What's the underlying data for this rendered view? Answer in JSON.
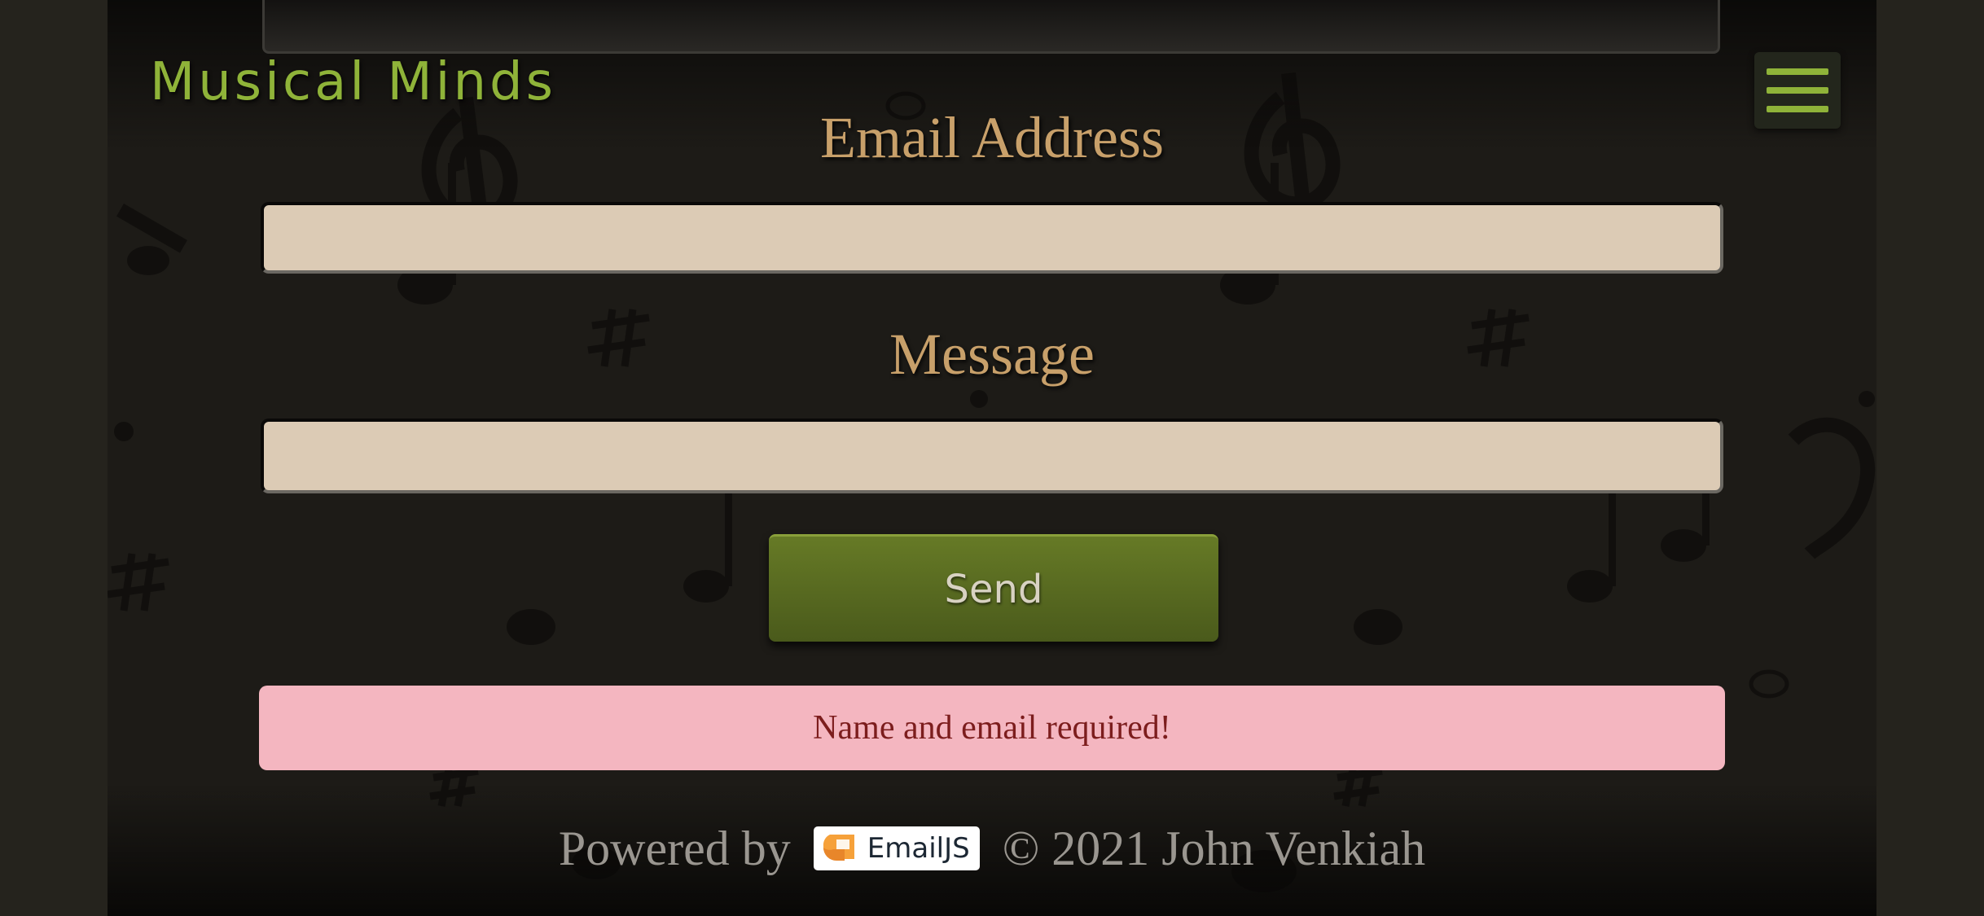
{
  "header": {
    "brand": "Musical Minds",
    "menu_icon": "hamburger-menu-icon"
  },
  "form": {
    "email_label": "Email Address",
    "email_value": "",
    "message_label": "Message",
    "message_value": "",
    "send_label": "Send"
  },
  "alert": {
    "text": "Name and email required!"
  },
  "footer": {
    "powered_by": "Powered by",
    "badge_label": "EmailJS",
    "copyright": "© 2021 John Venkiah"
  },
  "colors": {
    "brand": "#8fb339",
    "label": "#c8a06a",
    "button": "#5a6c22",
    "alert_bg": "#f4b6c0",
    "alert_text": "#7c1d1d"
  }
}
